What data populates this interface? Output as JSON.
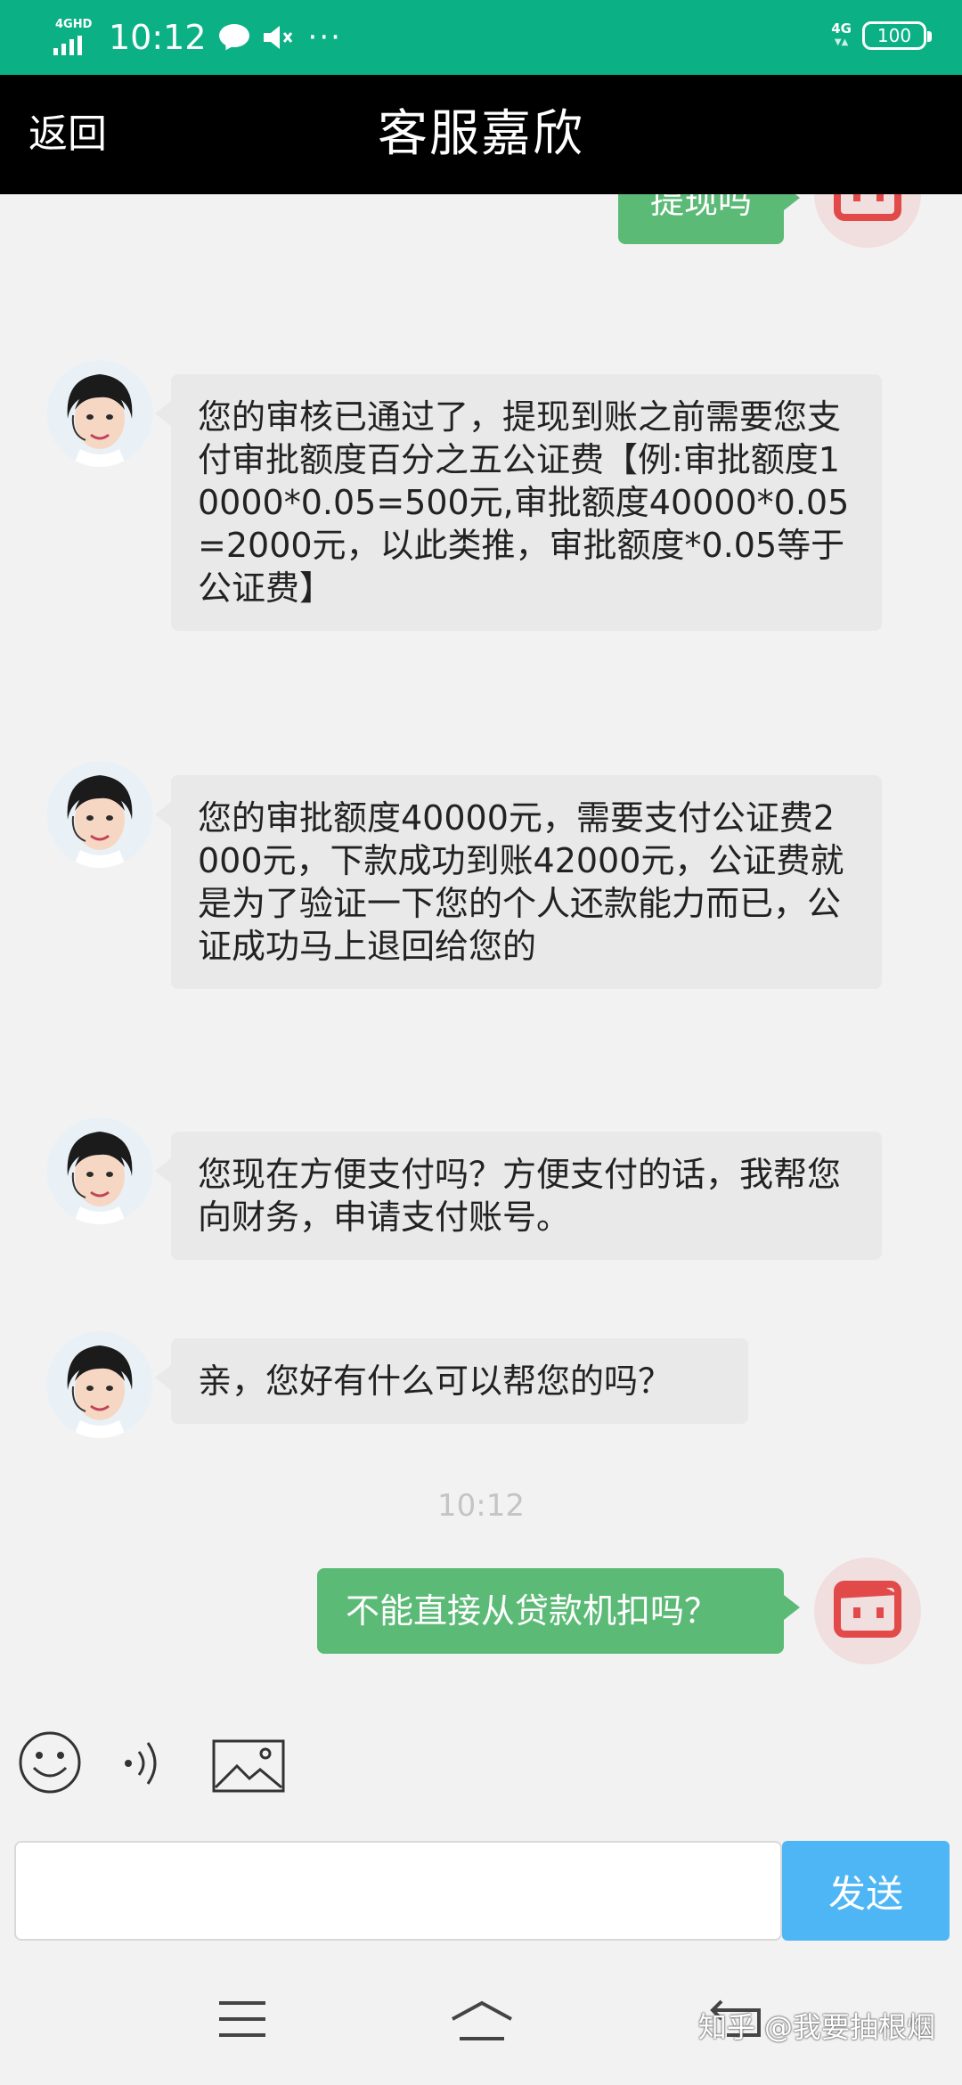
{
  "status_bar": {
    "network": "4GHD",
    "time": "10:12",
    "net_right": "4G",
    "battery": "100",
    "bg_color": "#0bb185"
  },
  "header": {
    "back_label": "返回",
    "title": "客服嘉欣"
  },
  "messages": {
    "partial_out": "提现吗",
    "m1": "您的审核已通过了，提现到账之前需要您支付审批额度百分之五公证费【例:审批额度10000*0.05=500元,审批额度40000*0.05=2000元，以此类推，审批额度*0.05等于公证费】",
    "m2": "您的审批额度40000元，需要支付公证费2000元，下款成功到账42000元，公证费就是为了验证一下您的个人还款能力而已，公证成功马上退回给您的",
    "m3": "您现在方便支付吗？方便支付的话，我帮您向财务，申请支付账号。",
    "m4": "亲，您好有什么可以帮您的吗？",
    "timestamp": "10:12",
    "out1": "不能直接从贷款机扣吗？"
  },
  "input": {
    "value": "",
    "send_label": "发送"
  },
  "icons": {
    "emoji": "smiley-icon",
    "voice": "voice-icon",
    "image": "image-icon",
    "menu": "menu-icon",
    "home": "home-icon",
    "back": "back-icon"
  },
  "colors": {
    "incoming_bubble": "#e9e9e9",
    "outgoing_bubble": "#5cba77",
    "send_button": "#4eb6f5",
    "header": "#000000"
  },
  "watermark": "知乎 @我要抽根烟"
}
